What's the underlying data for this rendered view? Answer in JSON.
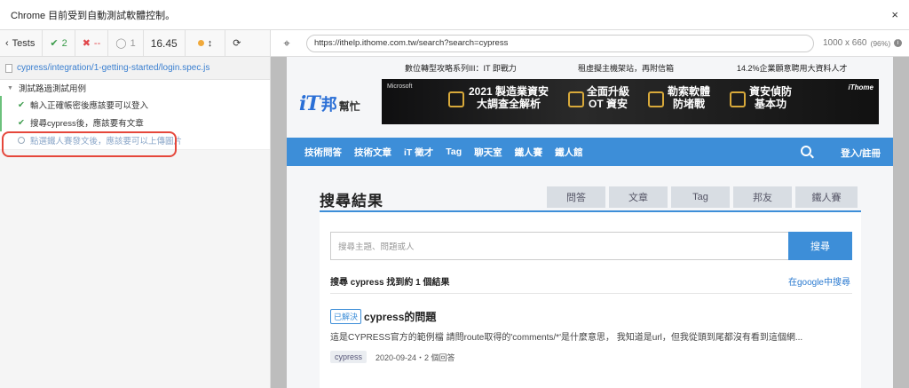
{
  "banner": {
    "text": "Chrome 目前受到自動測試軟體控制。",
    "close": "×"
  },
  "reporter": {
    "tests_label": "Tests",
    "passed": "2",
    "failed": "--",
    "pending": "1",
    "duration": "16.45"
  },
  "spec": {
    "path": "cypress/integration/1-getting-started/login.spec.js"
  },
  "suite": {
    "title": "測試路過測試用例",
    "tests": [
      {
        "title": "輸入正確帳密後應該要可以登入",
        "state": "passed"
      },
      {
        "title": "搜尋cypress後，應該要有文章",
        "state": "passed"
      },
      {
        "title": "點選鐵人賽發文後，應該要可以上傳圖片",
        "state": "pending"
      }
    ]
  },
  "browser": {
    "url": "https://ithelp.ithome.com.tw/search?search=cypress",
    "viewport": "1000 x 660",
    "zoom": "(96%)"
  },
  "site": {
    "top_links": [
      "數位轉型攻略系列III：IT 即戰力",
      "租虛擬主機架站，再附信箱",
      "14.2%企業願意聘用大資料人才"
    ],
    "logo_it": "iT",
    "logo_bang": "邦",
    "logo_help": "幫忙",
    "ad": {
      "brand": "Microsoft",
      "ithome": "iThome",
      "block1": "2021 製造業資安\n大調查全解析",
      "block2": "全面升級\nOT 資安",
      "block3": "勒索軟體\n防堵戰",
      "block4": "資安偵防\n基本功"
    },
    "nav": [
      "技術問答",
      "技術文章",
      "iT 徵才",
      "Tag",
      "聊天室",
      "鐵人賽",
      "鐵人館"
    ],
    "login": "登入/註冊"
  },
  "results": {
    "heading": "搜尋結果",
    "tabs": [
      "問答",
      "文章",
      "Tag",
      "邦友",
      "鐵人賽"
    ],
    "search_placeholder": "搜尋主題、問題或人",
    "search_button": "搜尋",
    "summary": "搜尋 cypress 找到約 1 個結果",
    "google_link": "在google中搜尋",
    "item": {
      "badge": "已解決",
      "title": "cypress的問題",
      "excerpt": "這是CYPRESS官方的範例檔 請問route取得的'comments/*'是什麼意思， 我知道是url，但我從頭到尾都沒有看到這個網...",
      "tag": "cypress",
      "meta": "2020-09-24・2 個回答"
    }
  },
  "colors": {
    "accent": "#3d8ed8",
    "pass": "#3a9b4a",
    "fail": "#e1474b",
    "highlight": "#e5473b"
  }
}
